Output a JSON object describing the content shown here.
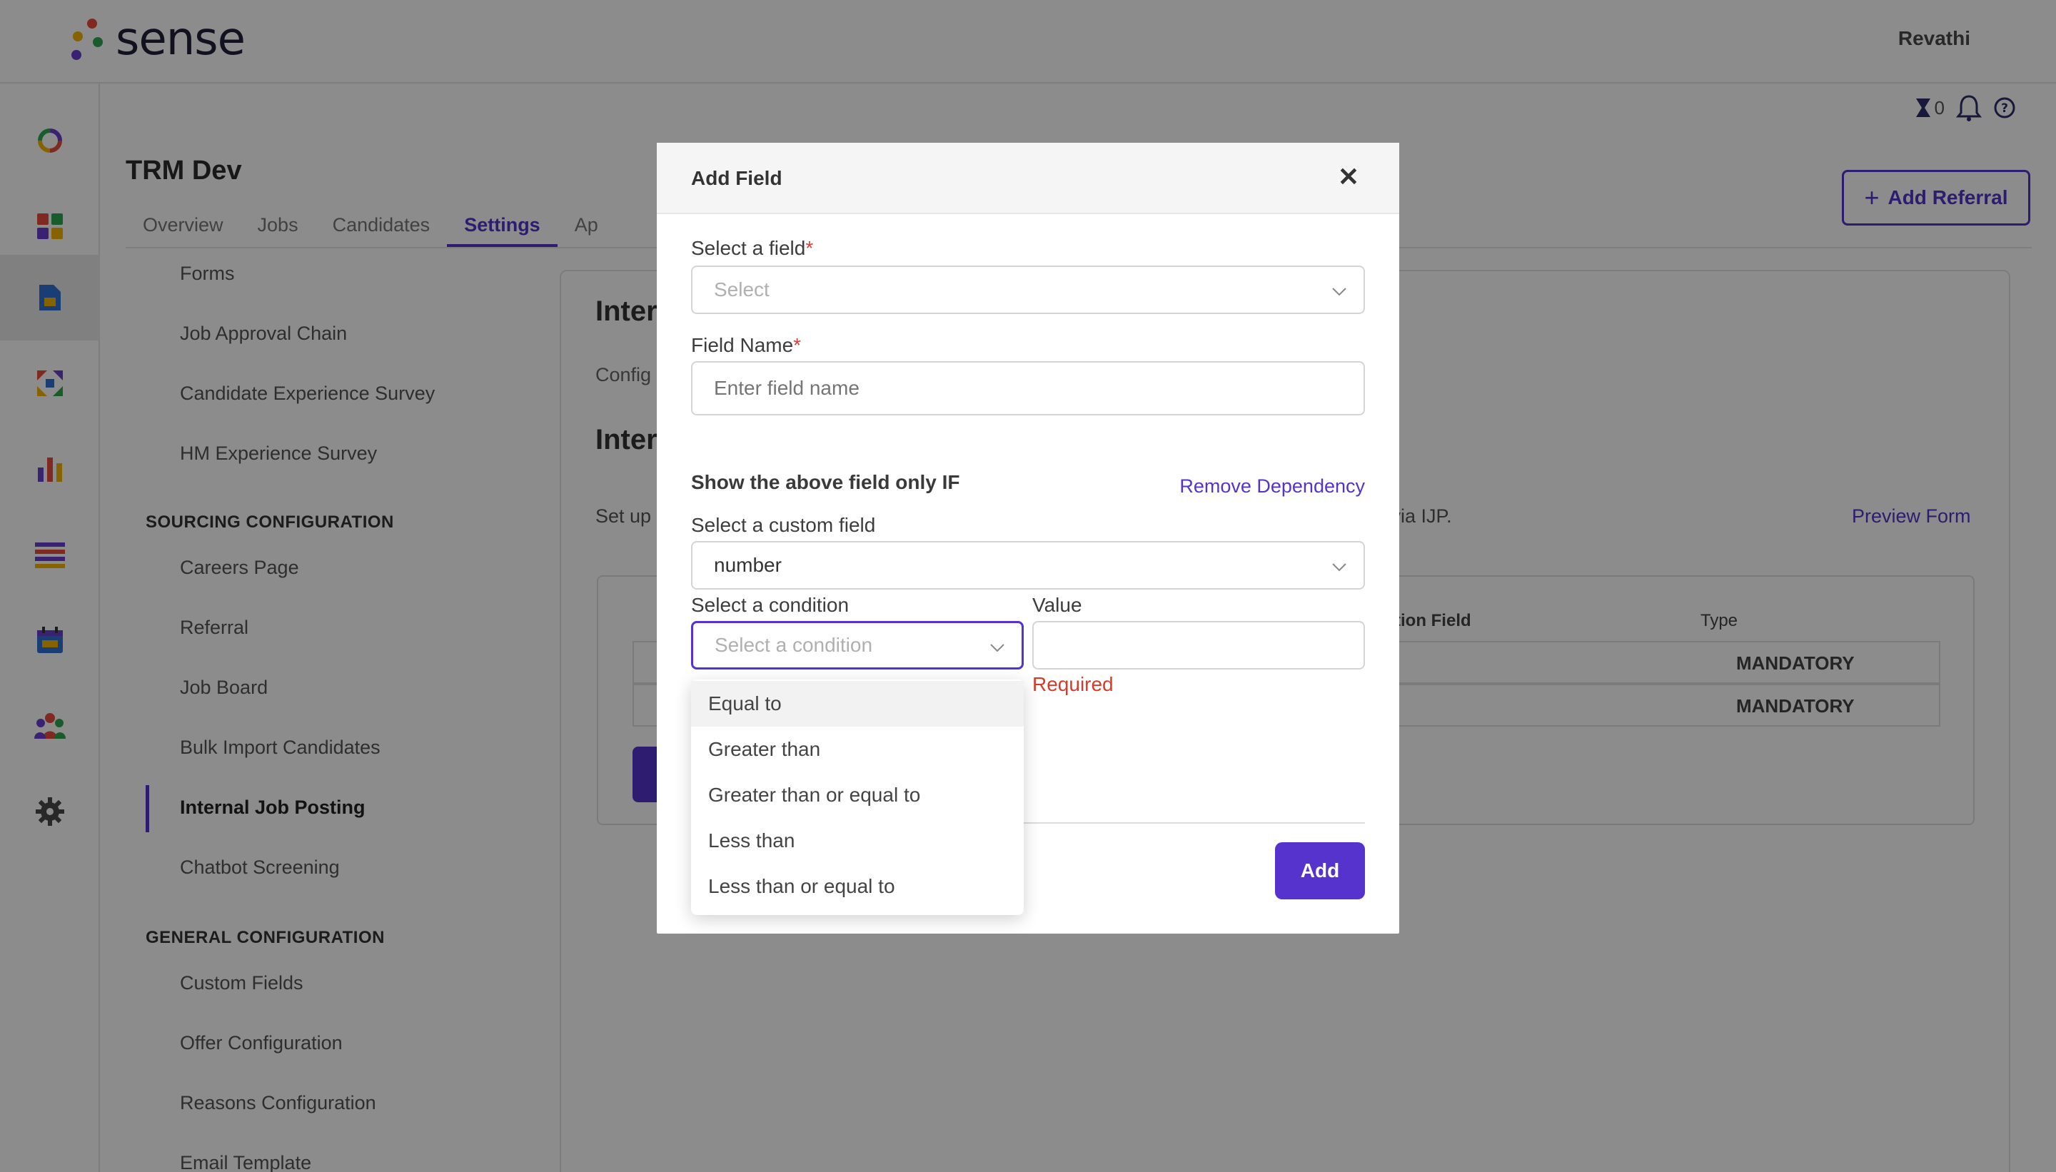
{
  "header": {
    "brand": "sense",
    "user_name": "Revathi"
  },
  "rail": {
    "icons": [
      "sense-ring-icon",
      "dashboard-icon",
      "document-icon",
      "referral-icon",
      "analytics-icon",
      "list-icon",
      "calendar-icon",
      "team-icon",
      "settings-gear-icon"
    ],
    "active_index": 2
  },
  "subbar": {
    "notifications_count": "0"
  },
  "page": {
    "title": "TRM Dev",
    "tabs": [
      {
        "label": "Overview"
      },
      {
        "label": "Jobs"
      },
      {
        "label": "Candidates"
      },
      {
        "label": "Settings"
      },
      {
        "label": "Ap"
      }
    ],
    "active_tab": "Settings",
    "add_referral_label": "Add Referral"
  },
  "settings_nav": {
    "top_items": [
      "Forms",
      "Job Approval Chain",
      "Candidate Experience Survey",
      "HM Experience Survey"
    ],
    "sourcing_header": "SOURCING CONFIGURATION",
    "sourcing_items": [
      "Careers Page",
      "Referral",
      "Job Board",
      "Bulk Import Candidates",
      "Internal Job Posting",
      "Chatbot Screening"
    ],
    "active_item": "Internal Job Posting",
    "general_header": "GENERAL CONFIGURATION",
    "general_items": [
      "Custom Fields",
      "Offer Configuration",
      "Reasons Configuration",
      "Email Template"
    ]
  },
  "main": {
    "heading_partial": "Inter",
    "config_partial": "Config",
    "subheading_partial": "Inter",
    "setup_partial": "Set up",
    "ijp_partial": "b via IJP.",
    "preview_form": "Preview Form",
    "table": {
      "col_condition_field": "tion Field",
      "col_type": "Type",
      "rows": [
        {
          "type": "MANDATORY"
        },
        {
          "type": "MANDATORY"
        }
      ]
    }
  },
  "modal": {
    "title": "Add Field",
    "select_field_label": "Select a field",
    "select_field_placeholder": "Select",
    "field_name_label": "Field Name",
    "field_name_placeholder": "Enter field name",
    "required_marker": "*",
    "dependency_title": "Show the above field only IF",
    "remove_dependency": "Remove Dependency",
    "custom_field_label": "Select a custom field",
    "custom_field_value": "number",
    "condition_label": "Select a condition",
    "condition_placeholder": "Select a condition",
    "value_label": "Value",
    "value_input": "",
    "required_message": "Required",
    "add_button": "Add",
    "condition_options": [
      {
        "label": "Equal to"
      },
      {
        "label": "Greater than"
      },
      {
        "label": "Greater than or equal to"
      },
      {
        "label": "Less than"
      },
      {
        "label": "Less than or equal to"
      }
    ]
  },
  "colors": {
    "accent": "#5533cc",
    "error": "#d93a2a",
    "overlay": "rgba(0,0,0,0.45)"
  }
}
